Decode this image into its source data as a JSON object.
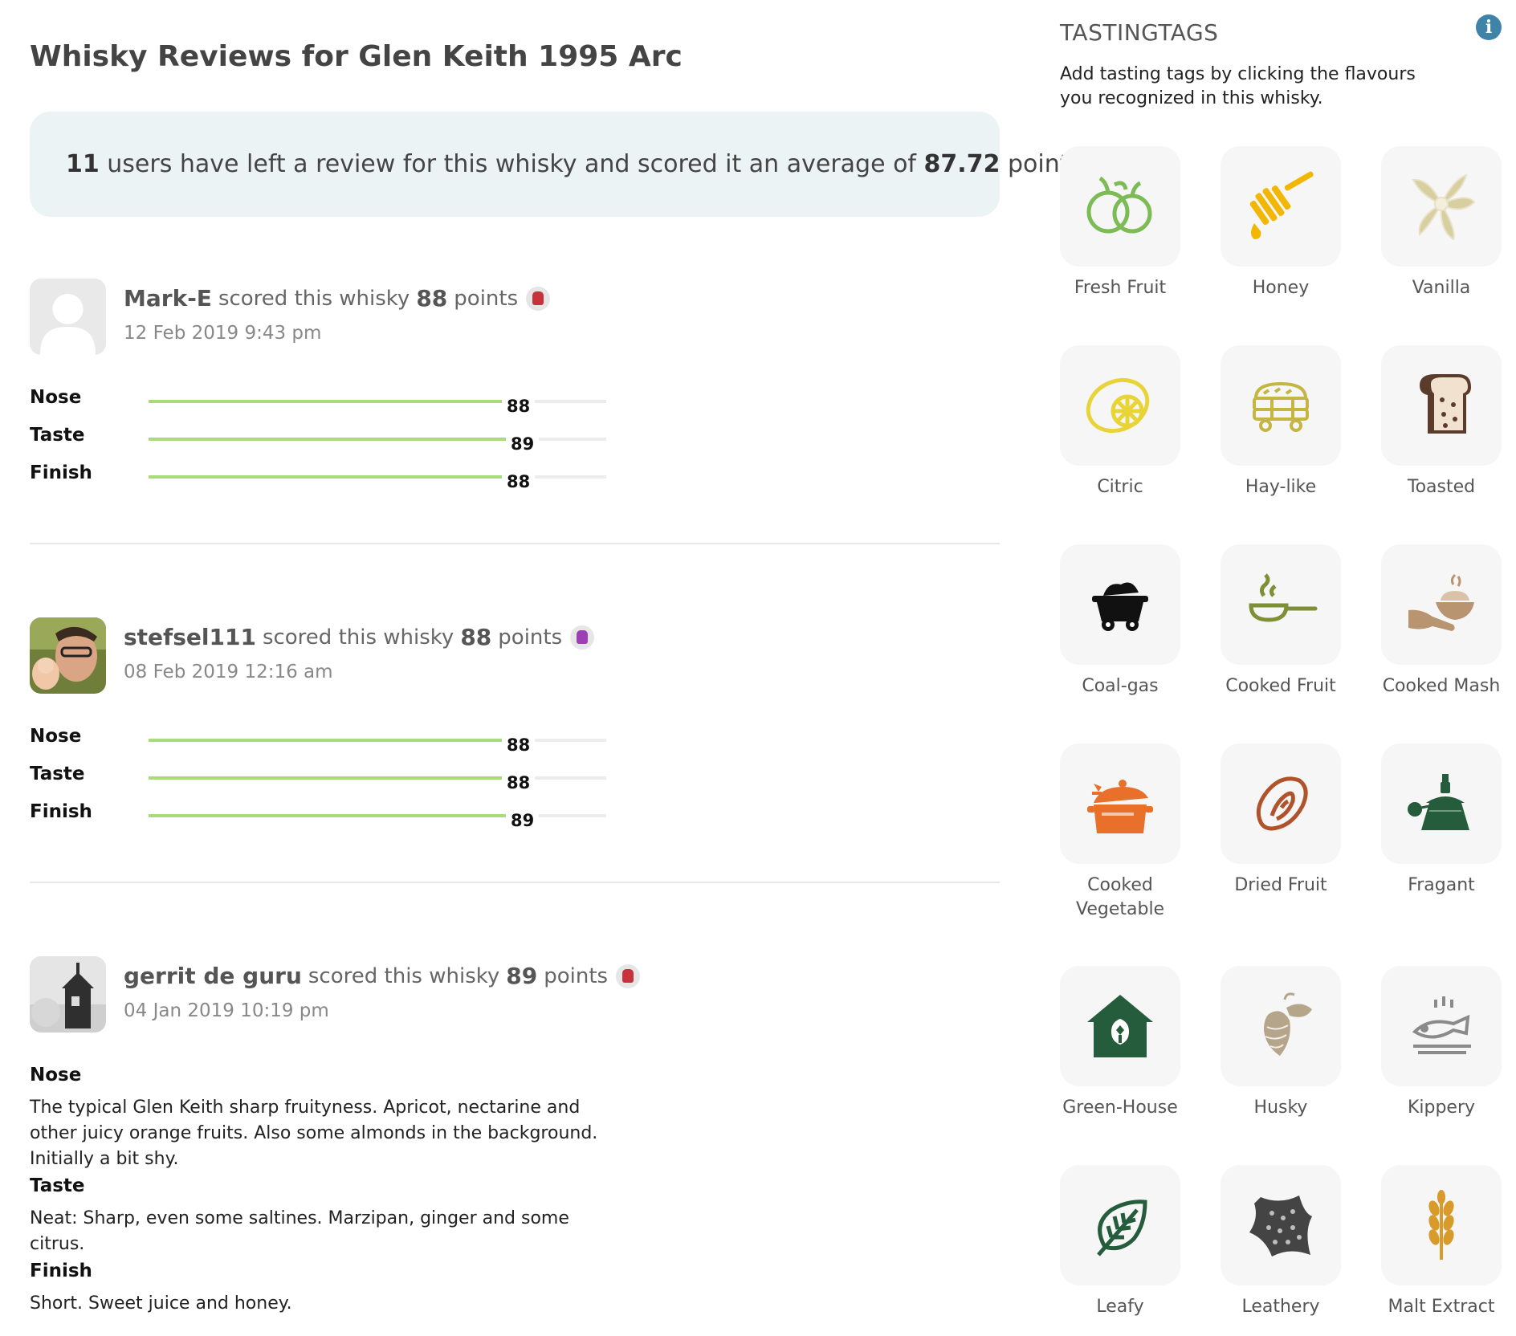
{
  "page": {
    "title": "Whisky Reviews for Glen Keith 1995 Arc"
  },
  "summary": {
    "count": "11",
    "mid_text": " users have left a review for this whisky and scored it an average of ",
    "average": "87.72",
    "end_text": " points"
  },
  "reviews": [
    {
      "username": "Mark-E",
      "scored_text": "scored this whisky",
      "points": "88",
      "points_word": "points",
      "date": "12 Feb 2019 9:43 pm",
      "avatar": "default-user-avatar",
      "medal_color": "#c8323a",
      "scores": [
        {
          "label": "Nose",
          "value": 88
        },
        {
          "label": "Taste",
          "value": 89
        },
        {
          "label": "Finish",
          "value": 88
        }
      ]
    },
    {
      "username": "stefsel111",
      "scored_text": "scored this whisky",
      "points": "88",
      "points_word": "points",
      "date": "08 Feb 2019 12:16 am",
      "avatar": "photo-avatar",
      "medal_color": "#9d3fb5",
      "scores": [
        {
          "label": "Nose",
          "value": 88
        },
        {
          "label": "Taste",
          "value": 88
        },
        {
          "label": "Finish",
          "value": 89
        }
      ]
    },
    {
      "username": "gerrit de guru",
      "scored_text": "scored this whisky",
      "points": "89",
      "points_word": "points",
      "date": "04 Jan 2019 10:19 pm",
      "avatar": "photo-avatar",
      "medal_color": "#c8323a",
      "notes": {
        "nose_label": "Nose",
        "nose_text": "The typical Glen Keith sharp fruityness. Apricot, nectarine and other juicy orange fruits. Also some almonds in the background. Initially a bit shy.",
        "taste_label": "Taste",
        "taste_text": "Neat: Sharp, even some saltines. Marzipan, ginger and some citrus.",
        "finish_label": "Finish",
        "finish_text": "Short. Sweet juice and honey."
      }
    }
  ],
  "tastingtags": {
    "title": "TASTINGTAGS",
    "description": "Add tasting tags by clicking the flavours you recognized in this whisky.",
    "info_icon": "info-icon",
    "tags": [
      {
        "label": "Fresh Fruit",
        "icon": "apples-icon",
        "color": "#7dbb55"
      },
      {
        "label": "Honey",
        "icon": "honey-dipper-icon",
        "color": "#f2b705"
      },
      {
        "label": "Vanilla",
        "icon": "vanilla-flower-icon",
        "color": "#d8cfa0"
      },
      {
        "label": "Citric",
        "icon": "lemon-slice-icon",
        "color": "#e9d437"
      },
      {
        "label": "Hay-like",
        "icon": "hay-bale-icon",
        "color": "#c4b640"
      },
      {
        "label": "Toasted",
        "icon": "toast-icon",
        "color": "#5a3b2c"
      },
      {
        "label": "Coal-gas",
        "icon": "coal-cart-icon",
        "color": "#111111"
      },
      {
        "label": "Cooked Fruit",
        "icon": "frying-pan-icon",
        "color": "#7e8f35"
      },
      {
        "label": "Cooked Mash",
        "icon": "hand-bowl-icon",
        "color": "#b89470"
      },
      {
        "label": "Cooked Vegetable",
        "icon": "cooking-pot-icon",
        "color": "#e8702a"
      },
      {
        "label": "Dried Fruit",
        "icon": "dried-fruit-icon",
        "color": "#b0532a"
      },
      {
        "label": "Fragant",
        "icon": "perfume-bottle-icon",
        "color": "#245c3c"
      },
      {
        "label": "Green-House",
        "icon": "greenhouse-icon",
        "color": "#245c3c"
      },
      {
        "label": "Husky",
        "icon": "hop-cone-icon",
        "color": "#b5a58a"
      },
      {
        "label": "Kippery",
        "icon": "smoked-fish-icon",
        "color": "#8a8a8a"
      },
      {
        "label": "Leafy",
        "icon": "leaf-icon",
        "color": "#245c3c"
      },
      {
        "label": "Leathery",
        "icon": "leather-hide-icon",
        "color": "#444444"
      },
      {
        "label": "Malt Extract",
        "icon": "wheat-ear-icon",
        "color": "#d89a2a"
      }
    ]
  }
}
